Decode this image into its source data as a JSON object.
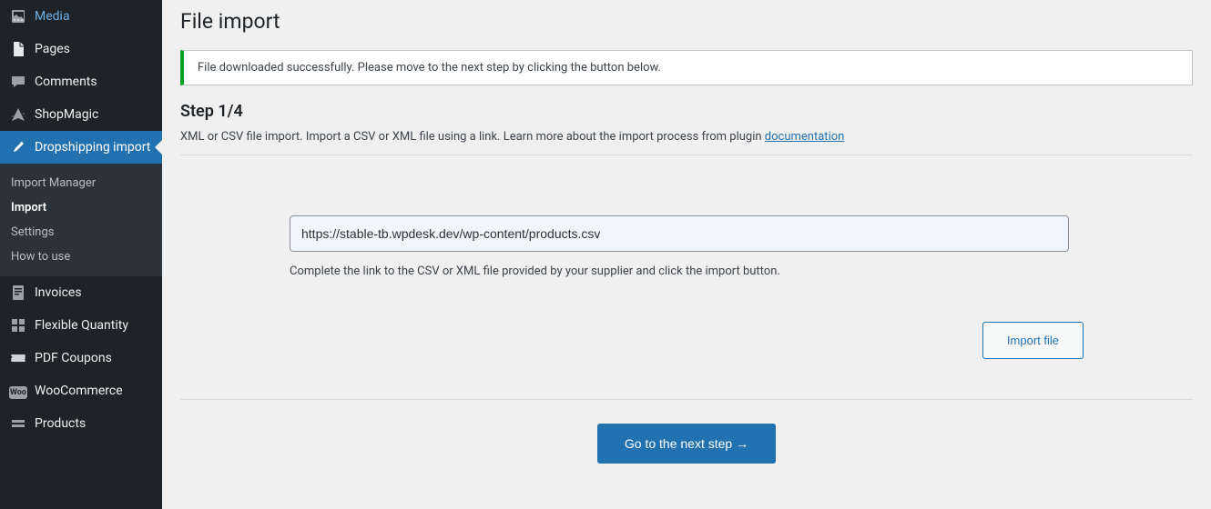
{
  "sidebar": {
    "items": [
      {
        "label": "Media"
      },
      {
        "label": "Pages"
      },
      {
        "label": "Comments"
      },
      {
        "label": "ShopMagic"
      },
      {
        "label": "Dropshipping import"
      },
      {
        "label": "Invoices"
      },
      {
        "label": "Flexible Quantity"
      },
      {
        "label": "PDF Coupons"
      },
      {
        "label": "WooCommerce"
      },
      {
        "label": "Products"
      }
    ],
    "submenu": [
      {
        "label": "Import Manager"
      },
      {
        "label": "Import"
      },
      {
        "label": "Settings"
      },
      {
        "label": "How to use"
      }
    ]
  },
  "main": {
    "page_title": "File import",
    "notice": "File downloaded successfully. Please move to the next step by clicking the button below.",
    "step_title": "Step 1/4",
    "description_prefix": "XML or CSV file import. Import a CSV or XML file using a link. Learn more about the import process from plugin ",
    "documentation_link": "documentation",
    "url_value": "https://stable-tb.wpdesk.dev/wp-content/products.csv",
    "help_text": "Complete the link to the CSV or XML file provided by your supplier and click the import button.",
    "import_btn": "Import file",
    "next_btn": "Go to the next step →"
  }
}
